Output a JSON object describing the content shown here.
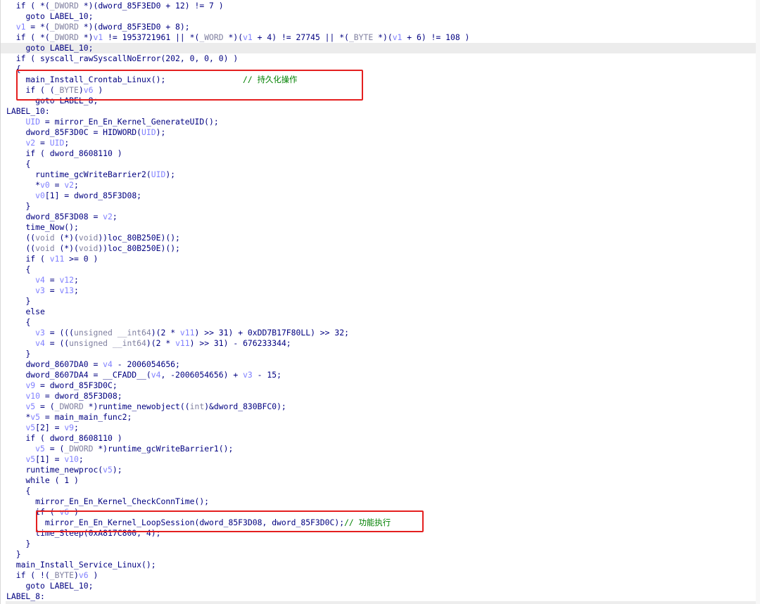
{
  "code": {
    "lines": [
      {
        "indent": "  ",
        "tokens": [
          [
            "id",
            "if ( *("
          ],
          [
            "type",
            "_DWORD"
          ],
          [
            "id",
            " *)(dword_85F3ED0 + 12) != 7 )"
          ]
        ]
      },
      {
        "indent": "    ",
        "tokens": [
          [
            "id",
            "goto LABEL_10;"
          ]
        ]
      },
      {
        "indent": "  ",
        "tokens": [
          [
            "var",
            "v1"
          ],
          [
            "id",
            " = *("
          ],
          [
            "type",
            "_DWORD"
          ],
          [
            "id",
            " *)(dword_85F3ED0 + 8);"
          ]
        ]
      },
      {
        "indent": "  ",
        "tokens": [
          [
            "id",
            "if ( *("
          ],
          [
            "type",
            "_DWORD"
          ],
          [
            "id",
            " *)"
          ],
          [
            "var",
            "v1"
          ],
          [
            "id",
            " != 1953721961 || *("
          ],
          [
            "type",
            "_WORD"
          ],
          [
            "id",
            " *)("
          ],
          [
            "var",
            "v1"
          ],
          [
            "id",
            " + 4) != 27745 || *("
          ],
          [
            "type",
            "_BYTE"
          ],
          [
            "id",
            " *)("
          ],
          [
            "var",
            "v1"
          ],
          [
            "id",
            " + 6) != 108 )"
          ]
        ]
      },
      {
        "indent": "    ",
        "tokens": [
          [
            "id",
            "goto LABEL_10;"
          ]
        ],
        "highlight": true
      },
      {
        "indent": "  ",
        "tokens": [
          [
            "id",
            "if ( syscall_rawSyscallNoError(202, 0, 0, 0) )"
          ]
        ]
      },
      {
        "indent": "  ",
        "tokens": [
          [
            "id",
            "{"
          ]
        ]
      },
      {
        "indent": "    ",
        "tokens": [
          [
            "id",
            "main_Install_Crontab_Linux();"
          ],
          [
            "cmt",
            "                // 持久化操作"
          ]
        ]
      },
      {
        "indent": "    ",
        "tokens": [
          [
            "id",
            "if ( ("
          ],
          [
            "type",
            "_BYTE"
          ],
          [
            "id",
            ")"
          ],
          [
            "var",
            "v6"
          ],
          [
            "id",
            " )"
          ]
        ]
      },
      {
        "indent": "      ",
        "tokens": [
          [
            "id",
            "goto LABEL_8;"
          ]
        ]
      },
      {
        "indent": "",
        "tokens": [
          [
            "id",
            "LABEL_10:"
          ]
        ]
      },
      {
        "indent": "    ",
        "tokens": [
          [
            "var",
            "UID"
          ],
          [
            "id",
            " = mirror_En_En_Kernel_GenerateUID();"
          ]
        ]
      },
      {
        "indent": "    ",
        "tokens": [
          [
            "id",
            "dword_85F3D0C = HIDWORD("
          ],
          [
            "var",
            "UID"
          ],
          [
            "id",
            ");"
          ]
        ]
      },
      {
        "indent": "    ",
        "tokens": [
          [
            "var",
            "v2"
          ],
          [
            "id",
            " = "
          ],
          [
            "var",
            "UID"
          ],
          [
            "id",
            ";"
          ]
        ]
      },
      {
        "indent": "    ",
        "tokens": [
          [
            "id",
            "if ( dword_8608110 )"
          ]
        ]
      },
      {
        "indent": "    ",
        "tokens": [
          [
            "id",
            "{"
          ]
        ]
      },
      {
        "indent": "      ",
        "tokens": [
          [
            "id",
            "runtime_gcWriteBarrier2("
          ],
          [
            "var",
            "UID"
          ],
          [
            "id",
            ");"
          ]
        ]
      },
      {
        "indent": "      ",
        "tokens": [
          [
            "id",
            "*"
          ],
          [
            "var",
            "v0"
          ],
          [
            "id",
            " = "
          ],
          [
            "var",
            "v2"
          ],
          [
            "id",
            ";"
          ]
        ]
      },
      {
        "indent": "      ",
        "tokens": [
          [
            "var",
            "v0"
          ],
          [
            "id",
            "[1] = dword_85F3D08;"
          ]
        ]
      },
      {
        "indent": "    ",
        "tokens": [
          [
            "id",
            "}"
          ]
        ]
      },
      {
        "indent": "    ",
        "tokens": [
          [
            "id",
            "dword_85F3D08 = "
          ],
          [
            "var",
            "v2"
          ],
          [
            "id",
            ";"
          ]
        ]
      },
      {
        "indent": "    ",
        "tokens": [
          [
            "id",
            "time_Now();"
          ]
        ]
      },
      {
        "indent": "    ",
        "tokens": [
          [
            "id",
            "(("
          ],
          [
            "type",
            "void"
          ],
          [
            "id",
            " (*)("
          ],
          [
            "type",
            "void"
          ],
          [
            "id",
            "))loc_80B250E)();"
          ]
        ]
      },
      {
        "indent": "    ",
        "tokens": [
          [
            "id",
            "(("
          ],
          [
            "type",
            "void"
          ],
          [
            "id",
            " (*)("
          ],
          [
            "type",
            "void"
          ],
          [
            "id",
            "))loc_80B250E)();"
          ]
        ]
      },
      {
        "indent": "    ",
        "tokens": [
          [
            "id",
            "if ( "
          ],
          [
            "var",
            "v11"
          ],
          [
            "id",
            " >= 0 )"
          ]
        ]
      },
      {
        "indent": "    ",
        "tokens": [
          [
            "id",
            "{"
          ]
        ]
      },
      {
        "indent": "      ",
        "tokens": [
          [
            "var",
            "v4"
          ],
          [
            "id",
            " = "
          ],
          [
            "var",
            "v12"
          ],
          [
            "id",
            ";"
          ]
        ]
      },
      {
        "indent": "      ",
        "tokens": [
          [
            "var",
            "v3"
          ],
          [
            "id",
            " = "
          ],
          [
            "var",
            "v13"
          ],
          [
            "id",
            ";"
          ]
        ]
      },
      {
        "indent": "    ",
        "tokens": [
          [
            "id",
            "}"
          ]
        ]
      },
      {
        "indent": "    ",
        "tokens": [
          [
            "id",
            "else"
          ]
        ]
      },
      {
        "indent": "    ",
        "tokens": [
          [
            "id",
            "{"
          ]
        ]
      },
      {
        "indent": "      ",
        "tokens": [
          [
            "var",
            "v3"
          ],
          [
            "id",
            " = ((("
          ],
          [
            "type",
            "unsigned __int64"
          ],
          [
            "id",
            ")(2 * "
          ],
          [
            "var",
            "v11"
          ],
          [
            "id",
            ") >> 31) + 0xDD7B17F80LL) >> 32;"
          ]
        ]
      },
      {
        "indent": "      ",
        "tokens": [
          [
            "var",
            "v4"
          ],
          [
            "id",
            " = (("
          ],
          [
            "type",
            "unsigned __int64"
          ],
          [
            "id",
            ")(2 * "
          ],
          [
            "var",
            "v11"
          ],
          [
            "id",
            ") >> 31) - 676233344;"
          ]
        ]
      },
      {
        "indent": "    ",
        "tokens": [
          [
            "id",
            "}"
          ]
        ]
      },
      {
        "indent": "    ",
        "tokens": [
          [
            "id",
            "dword_8607DA0 = "
          ],
          [
            "var",
            "v4"
          ],
          [
            "id",
            " - 2006054656;"
          ]
        ]
      },
      {
        "indent": "    ",
        "tokens": [
          [
            "id",
            "dword_8607DA4 = __CFADD__("
          ],
          [
            "var",
            "v4"
          ],
          [
            "id",
            ", -2006054656) + "
          ],
          [
            "var",
            "v3"
          ],
          [
            "id",
            " - 15;"
          ]
        ]
      },
      {
        "indent": "    ",
        "tokens": [
          [
            "var",
            "v9"
          ],
          [
            "id",
            " = dword_85F3D0C;"
          ]
        ]
      },
      {
        "indent": "    ",
        "tokens": [
          [
            "var",
            "v10"
          ],
          [
            "id",
            " = dword_85F3D08;"
          ]
        ]
      },
      {
        "indent": "    ",
        "tokens": [
          [
            "var",
            "v5"
          ],
          [
            "id",
            " = ("
          ],
          [
            "type",
            "_DWORD"
          ],
          [
            "id",
            " *)runtime_newobject(("
          ],
          [
            "type",
            "int"
          ],
          [
            "id",
            ")&dword_830BFC0);"
          ]
        ]
      },
      {
        "indent": "    ",
        "tokens": [
          [
            "id",
            "*"
          ],
          [
            "var",
            "v5"
          ],
          [
            "id",
            " = main_main_func2;"
          ]
        ]
      },
      {
        "indent": "    ",
        "tokens": [
          [
            "var",
            "v5"
          ],
          [
            "id",
            "[2] = "
          ],
          [
            "var",
            "v9"
          ],
          [
            "id",
            ";"
          ]
        ]
      },
      {
        "indent": "    ",
        "tokens": [
          [
            "id",
            "if ( dword_8608110 )"
          ]
        ]
      },
      {
        "indent": "      ",
        "tokens": [
          [
            "var",
            "v5"
          ],
          [
            "id",
            " = ("
          ],
          [
            "type",
            "_DWORD"
          ],
          [
            "id",
            " *)runtime_gcWriteBarrier1();"
          ]
        ]
      },
      {
        "indent": "    ",
        "tokens": [
          [
            "var",
            "v5"
          ],
          [
            "id",
            "[1] = "
          ],
          [
            "var",
            "v10"
          ],
          [
            "id",
            ";"
          ]
        ]
      },
      {
        "indent": "    ",
        "tokens": [
          [
            "id",
            "runtime_newproc("
          ],
          [
            "var",
            "v5"
          ],
          [
            "id",
            ");"
          ]
        ]
      },
      {
        "indent": "    ",
        "tokens": [
          [
            "id",
            "while ( 1 )"
          ]
        ]
      },
      {
        "indent": "    ",
        "tokens": [
          [
            "id",
            "{"
          ]
        ]
      },
      {
        "indent": "      ",
        "tokens": [
          [
            "id",
            "mirror_En_En_Kernel_CheckConnTime();"
          ]
        ]
      },
      {
        "indent": "      ",
        "tokens": [
          [
            "id",
            "if ( "
          ],
          [
            "var",
            "v6"
          ],
          [
            "id",
            " )"
          ]
        ]
      },
      {
        "indent": "        ",
        "tokens": [
          [
            "id",
            "mirror_En_En_Kernel_LoopSession(dword_85F3D08, dword_85F3D0C);"
          ],
          [
            "cmt",
            "// 功能执行"
          ]
        ]
      },
      {
        "indent": "      ",
        "tokens": [
          [
            "id",
            "time_Sleep(0xA817C800, 4);"
          ]
        ]
      },
      {
        "indent": "    ",
        "tokens": [
          [
            "id",
            "}"
          ]
        ]
      },
      {
        "indent": "  ",
        "tokens": [
          [
            "id",
            "}"
          ]
        ]
      },
      {
        "indent": "  ",
        "tokens": [
          [
            "id",
            "main_Install_Service_Linux();"
          ]
        ]
      },
      {
        "indent": "  ",
        "tokens": [
          [
            "id",
            "if ( !("
          ],
          [
            "type",
            "_BYTE"
          ],
          [
            "id",
            ")"
          ],
          [
            "var",
            "v6"
          ],
          [
            "id",
            " )"
          ]
        ]
      },
      {
        "indent": "    ",
        "tokens": [
          [
            "id",
            "goto LABEL_10;"
          ]
        ]
      },
      {
        "indent": "",
        "tokens": [
          [
            "id",
            "LABEL_8:"
          ]
        ]
      }
    ]
  },
  "colors": {
    "identifier": "#000080",
    "variable": "#8080ff",
    "type": "#8080a0",
    "comment": "#008000",
    "annotation_box": "#e41f1f",
    "highlight_line": "#ececec"
  }
}
